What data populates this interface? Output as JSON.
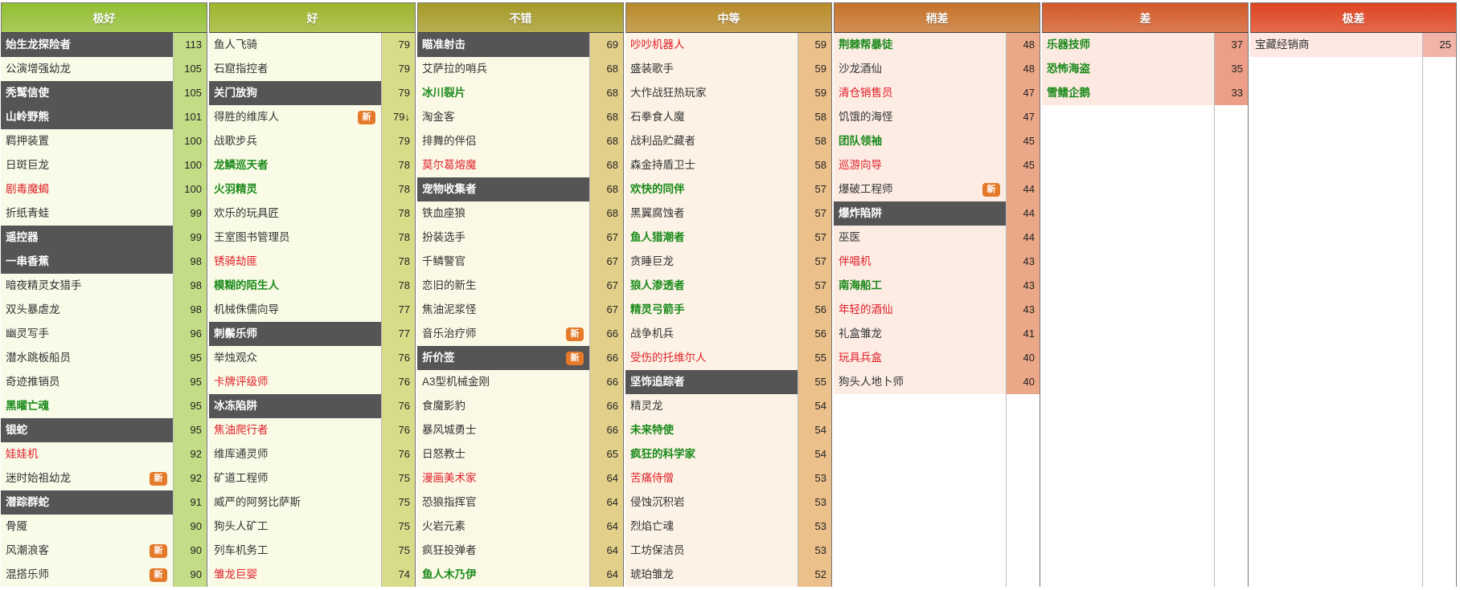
{
  "tiers": [
    {
      "label": "极好",
      "header_color": "#93bf32",
      "name_bg": "#f7fbe8",
      "score_bg": "#c3dd86",
      "rows": [
        {
          "name": "始生龙探险者",
          "score": "113",
          "style": "dark"
        },
        {
          "name": "公演增强幼龙",
          "score": "105",
          "style": "normal"
        },
        {
          "name": "秃鹫信使",
          "score": "105",
          "style": "dark"
        },
        {
          "name": "山岭野熊",
          "score": "101",
          "style": "dark"
        },
        {
          "name": "羁押装置",
          "score": "100",
          "style": "normal"
        },
        {
          "name": "日斑巨龙",
          "score": "100",
          "style": "normal"
        },
        {
          "name": "剧毒魔蝎",
          "score": "100",
          "style": "red"
        },
        {
          "name": "折纸青蛙",
          "score": "99",
          "style": "normal"
        },
        {
          "name": "遥控器",
          "score": "99",
          "style": "dark"
        },
        {
          "name": "一串香蕉",
          "score": "98",
          "style": "dark"
        },
        {
          "name": "暗夜精灵女猎手",
          "score": "98",
          "style": "normal"
        },
        {
          "name": "双头暴虐龙",
          "score": "98",
          "style": "normal"
        },
        {
          "name": "幽灵写手",
          "score": "96",
          "style": "normal"
        },
        {
          "name": "潜水跳板船员",
          "score": "95",
          "style": "normal"
        },
        {
          "name": "奇迹推销员",
          "score": "95",
          "style": "normal"
        },
        {
          "name": "黑曜亡魂",
          "score": "95",
          "style": "green"
        },
        {
          "name": "银蛇",
          "score": "95",
          "style": "dark"
        },
        {
          "name": "娃娃机",
          "score": "92",
          "style": "red"
        },
        {
          "name": "迷时始祖幼龙",
          "score": "92",
          "style": "normal",
          "badge": "新"
        },
        {
          "name": "潜踪群蛇",
          "score": "91",
          "style": "dark"
        },
        {
          "name": "骨魇",
          "score": "90",
          "style": "normal"
        },
        {
          "name": "风潮浪客",
          "score": "90",
          "style": "normal",
          "badge": "新"
        },
        {
          "name": "混搭乐师",
          "score": "90",
          "style": "normal",
          "badge": "新"
        }
      ]
    },
    {
      "label": "好",
      "header_color": "#a0b42c",
      "name_bg": "#fafbe6",
      "score_bg": "#d8dc88",
      "rows": [
        {
          "name": "鱼人飞骑",
          "score": "79",
          "style": "normal"
        },
        {
          "name": "石窟指控者",
          "score": "79",
          "style": "normal"
        },
        {
          "name": "关门放狗",
          "score": "79",
          "style": "dark"
        },
        {
          "name": "得胜的维库人",
          "score": "79↓",
          "style": "normal",
          "badge": "新"
        },
        {
          "name": "战歌步兵",
          "score": "79",
          "style": "normal"
        },
        {
          "name": "龙鳞巡天者",
          "score": "78",
          "style": "green"
        },
        {
          "name": "火羽精灵",
          "score": "78",
          "style": "green"
        },
        {
          "name": "欢乐的玩具匠",
          "score": "78",
          "style": "normal"
        },
        {
          "name": "王室图书管理员",
          "score": "78",
          "style": "normal"
        },
        {
          "name": "锈骑劫匪",
          "score": "78",
          "style": "red"
        },
        {
          "name": "模糊的陌生人",
          "score": "78",
          "style": "green"
        },
        {
          "name": "机械侏儒向导",
          "score": "77",
          "style": "normal"
        },
        {
          "name": "刺鬃乐师",
          "score": "77",
          "style": "dark"
        },
        {
          "name": "举烛观众",
          "score": "76",
          "style": "normal"
        },
        {
          "name": "卡牌评级师",
          "score": "76",
          "style": "red"
        },
        {
          "name": "冰冻陷阱",
          "score": "76",
          "style": "dark"
        },
        {
          "name": "焦油爬行者",
          "score": "76",
          "style": "red"
        },
        {
          "name": "维库通灵师",
          "score": "76",
          "style": "normal"
        },
        {
          "name": "矿道工程师",
          "score": "75",
          "style": "normal"
        },
        {
          "name": "威严的阿努比萨斯",
          "score": "75",
          "style": "normal"
        },
        {
          "name": "狗头人矿工",
          "score": "75",
          "style": "normal"
        },
        {
          "name": "列车机务工",
          "score": "75",
          "style": "normal"
        },
        {
          "name": "雏龙巨婴",
          "score": "74",
          "style": "red"
        }
      ]
    },
    {
      "label": "不错",
      "header_color": "#a59a26",
      "name_bg": "#fbf8e6",
      "score_bg": "#e2d08a",
      "rows": [
        {
          "name": "瞄准射击",
          "score": "69",
          "style": "dark"
        },
        {
          "name": "艾萨拉的哨兵",
          "score": "68",
          "style": "normal"
        },
        {
          "name": "冰川裂片",
          "score": "68",
          "style": "green"
        },
        {
          "name": "淘金客",
          "score": "68",
          "style": "normal"
        },
        {
          "name": "排舞的伴侣",
          "score": "68",
          "style": "normal"
        },
        {
          "name": "莫尔葛熔魔",
          "score": "68",
          "style": "red"
        },
        {
          "name": "宠物收集者",
          "score": "68",
          "style": "dark"
        },
        {
          "name": "铁血座狼",
          "score": "68",
          "style": "normal"
        },
        {
          "name": "扮装选手",
          "score": "67",
          "style": "normal"
        },
        {
          "name": "千鳞警官",
          "score": "67",
          "style": "normal"
        },
        {
          "name": "恋旧的新生",
          "score": "67",
          "style": "normal"
        },
        {
          "name": "焦油泥浆怪",
          "score": "67",
          "style": "normal"
        },
        {
          "name": "音乐治疗师",
          "score": "66",
          "style": "normal",
          "badge": "新"
        },
        {
          "name": "折价签",
          "score": "66",
          "style": "dark",
          "badge": "新"
        },
        {
          "name": "A3型机械金刚",
          "score": "66",
          "style": "normal"
        },
        {
          "name": "食魔影豹",
          "score": "66",
          "style": "normal"
        },
        {
          "name": "暴风城勇士",
          "score": "66",
          "style": "normal"
        },
        {
          "name": "日怒教士",
          "score": "65",
          "style": "normal"
        },
        {
          "name": "漫画美术家",
          "score": "64",
          "style": "red"
        },
        {
          "name": "恐狼指挥官",
          "score": "64",
          "style": "normal"
        },
        {
          "name": "火岩元素",
          "score": "64",
          "style": "normal"
        },
        {
          "name": "疯狂投弹者",
          "score": "64",
          "style": "normal"
        },
        {
          "name": "鱼人木乃伊",
          "score": "64",
          "style": "green"
        }
      ]
    },
    {
      "label": "中等",
      "header_color": "#b88a2a",
      "name_bg": "#fcf3e6",
      "score_bg": "#ebc08a",
      "rows": [
        {
          "name": "吵吵机器人",
          "score": "59",
          "style": "red"
        },
        {
          "name": "盛装歌手",
          "score": "59",
          "style": "normal"
        },
        {
          "name": "大作战狂热玩家",
          "score": "59",
          "style": "normal"
        },
        {
          "name": "石拳食人魔",
          "score": "58",
          "style": "normal"
        },
        {
          "name": "战利品贮藏者",
          "score": "58",
          "style": "normal"
        },
        {
          "name": "森金持盾卫士",
          "score": "58",
          "style": "normal"
        },
        {
          "name": "欢快的同伴",
          "score": "57",
          "style": "green"
        },
        {
          "name": "黑翼腐蚀者",
          "score": "57",
          "style": "normal"
        },
        {
          "name": "鱼人猎潮者",
          "score": "57",
          "style": "green"
        },
        {
          "name": "贪睡巨龙",
          "score": "57",
          "style": "normal"
        },
        {
          "name": "狼人渗透者",
          "score": "57",
          "style": "green"
        },
        {
          "name": "精灵弓箭手",
          "score": "56",
          "style": "green"
        },
        {
          "name": "战争机兵",
          "score": "56",
          "style": "normal"
        },
        {
          "name": "受伤的托维尔人",
          "score": "55",
          "style": "red"
        },
        {
          "name": "坚饰追踪者",
          "score": "55",
          "style": "dark"
        },
        {
          "name": "精灵龙",
          "score": "54",
          "style": "normal"
        },
        {
          "name": "未来特使",
          "score": "54",
          "style": "green"
        },
        {
          "name": "疯狂的科学家",
          "score": "54",
          "style": "green"
        },
        {
          "name": "苦痛侍僧",
          "score": "53",
          "style": "red"
        },
        {
          "name": "侵蚀沉积岩",
          "score": "53",
          "style": "normal"
        },
        {
          "name": "烈焰亡魂",
          "score": "53",
          "style": "normal"
        },
        {
          "name": "工坊保洁员",
          "score": "53",
          "style": "normal"
        },
        {
          "name": "琥珀雏龙",
          "score": "52",
          "style": "normal"
        }
      ]
    },
    {
      "label": "稍差",
      "header_color": "#c6722a",
      "name_bg": "#fcece4",
      "score_bg": "#eba888",
      "rows": [
        {
          "name": "荆棘帮暴徒",
          "score": "48",
          "style": "green"
        },
        {
          "name": "沙龙酒仙",
          "score": "48",
          "style": "normal"
        },
        {
          "name": "清仓销售员",
          "score": "47",
          "style": "red"
        },
        {
          "name": "饥饿的海怪",
          "score": "47",
          "style": "normal"
        },
        {
          "name": "团队领袖",
          "score": "45",
          "style": "green"
        },
        {
          "name": "巡游向导",
          "score": "45",
          "style": "red"
        },
        {
          "name": "爆破工程师",
          "score": "44",
          "style": "normal",
          "badge": "新"
        },
        {
          "name": "爆炸陷阱",
          "score": "44",
          "style": "dark"
        },
        {
          "name": "巫医",
          "score": "44",
          "style": "normal"
        },
        {
          "name": "伴唱机",
          "score": "43",
          "style": "red"
        },
        {
          "name": "南海船工",
          "score": "43",
          "style": "green"
        },
        {
          "name": "年轻的酒仙",
          "score": "43",
          "style": "red"
        },
        {
          "name": "礼盒雏龙",
          "score": "41",
          "style": "normal"
        },
        {
          "name": "玩具兵盒",
          "score": "40",
          "style": "red"
        },
        {
          "name": "狗头人地卜师",
          "score": "40",
          "style": "normal"
        },
        {
          "style": "empty"
        },
        {
          "style": "empty"
        },
        {
          "style": "empty"
        },
        {
          "style": "empty"
        },
        {
          "style": "empty"
        },
        {
          "style": "empty"
        },
        {
          "style": "empty"
        },
        {
          "style": "empty"
        }
      ]
    },
    {
      "label": "差",
      "header_color": "#d25a28",
      "name_bg": "#fce9e2",
      "score_bg": "#ec9f86",
      "rows": [
        {
          "name": "乐器技师",
          "score": "37",
          "style": "green"
        },
        {
          "name": "恐怖海盗",
          "score": "35",
          "style": "green"
        },
        {
          "name": "雪鳍企鹅",
          "score": "33",
          "style": "green"
        },
        {
          "style": "empty"
        },
        {
          "style": "empty"
        },
        {
          "style": "empty"
        },
        {
          "style": "empty"
        },
        {
          "style": "empty"
        },
        {
          "style": "empty"
        },
        {
          "style": "empty"
        },
        {
          "style": "empty"
        },
        {
          "style": "empty"
        },
        {
          "style": "empty"
        },
        {
          "style": "empty"
        },
        {
          "style": "empty"
        },
        {
          "style": "empty"
        },
        {
          "style": "empty"
        },
        {
          "style": "empty"
        },
        {
          "style": "empty"
        },
        {
          "style": "empty"
        },
        {
          "style": "empty"
        },
        {
          "style": "empty"
        },
        {
          "style": "empty"
        }
      ]
    },
    {
      "label": "极差",
      "header_color": "#de4420",
      "name_bg": "#fde8e4",
      "score_bg": "#f0b5a8",
      "rows": [
        {
          "name": "宝藏经销商",
          "score": "25",
          "style": "normal"
        },
        {
          "style": "empty"
        },
        {
          "style": "empty"
        },
        {
          "style": "empty"
        },
        {
          "style": "empty"
        },
        {
          "style": "empty"
        },
        {
          "style": "empty"
        },
        {
          "style": "empty"
        },
        {
          "style": "empty"
        },
        {
          "style": "empty"
        },
        {
          "style": "empty"
        },
        {
          "style": "empty"
        },
        {
          "style": "empty"
        },
        {
          "style": "empty"
        },
        {
          "style": "empty"
        },
        {
          "style": "empty"
        },
        {
          "style": "empty"
        },
        {
          "style": "empty"
        },
        {
          "style": "empty"
        },
        {
          "style": "empty"
        },
        {
          "style": "empty"
        },
        {
          "style": "empty"
        },
        {
          "style": "empty"
        }
      ]
    }
  ]
}
